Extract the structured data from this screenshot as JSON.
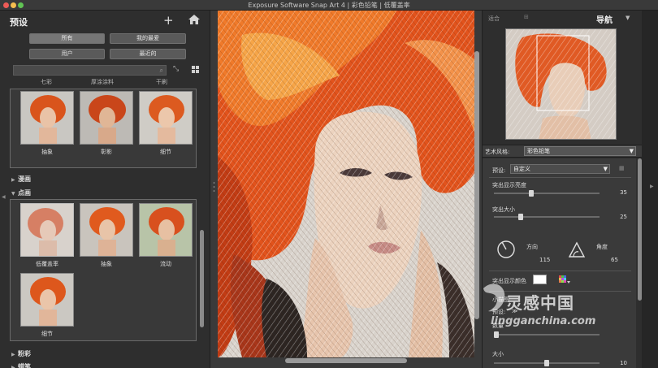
{
  "window": {
    "title": "Exposure Software Snap Art 4 | 彩色铅笔 | 低覆盖率"
  },
  "left_panel": {
    "title": "预设",
    "filters": [
      "所有",
      "我的最爱",
      "用户",
      "最近的"
    ],
    "search": {
      "value": "",
      "placeholder": ""
    },
    "cut_off_labels": [
      "七彩",
      "厚涂涂料",
      "干刷"
    ],
    "group1": {
      "items": [
        {
          "label": "抽象"
        },
        {
          "label": "彰影"
        },
        {
          "label": "细节"
        }
      ]
    },
    "categories": {
      "manga": "漫画",
      "pointillism": "点画",
      "pastel": "粉彩",
      "crayon": "蜡笔"
    },
    "pointillism_items": [
      {
        "label": "低覆盖率"
      },
      {
        "label": "抽象"
      },
      {
        "label": "流动"
      },
      {
        "label": "细节"
      }
    ]
  },
  "right_panel": {
    "tab_fit": "适合",
    "tab_other": "⊞",
    "title": "导航",
    "art_style_label": "艺术风格:",
    "art_style_value": "彩色铅笔",
    "preset_label": "预设:",
    "preset_value": "自定义",
    "sliders": [
      {
        "label": "突出显示亮度",
        "value": "35",
        "fraction": 0.35
      },
      {
        "label": "突出大小",
        "value": "25",
        "fraction": 0.25
      }
    ],
    "direction": {
      "label": "方向",
      "value": "115"
    },
    "angle": {
      "label": "角度",
      "value": "65"
    },
    "highlight_color_label": "突出显示颜色",
    "mini_strokes": {
      "title": "小描图",
      "preset_label": "预设:",
      "preset_value": "≫",
      "count_label": "数量",
      "size_label": "大小",
      "size_value": "10",
      "size_fraction": 0.5
    }
  },
  "watermark": {
    "text": "灵感中国",
    "url": "lingganchina.com"
  },
  "colors": {
    "hair": "#e2531c",
    "panel": "#2e2e2e",
    "accent_close": "#ee5b57"
  }
}
